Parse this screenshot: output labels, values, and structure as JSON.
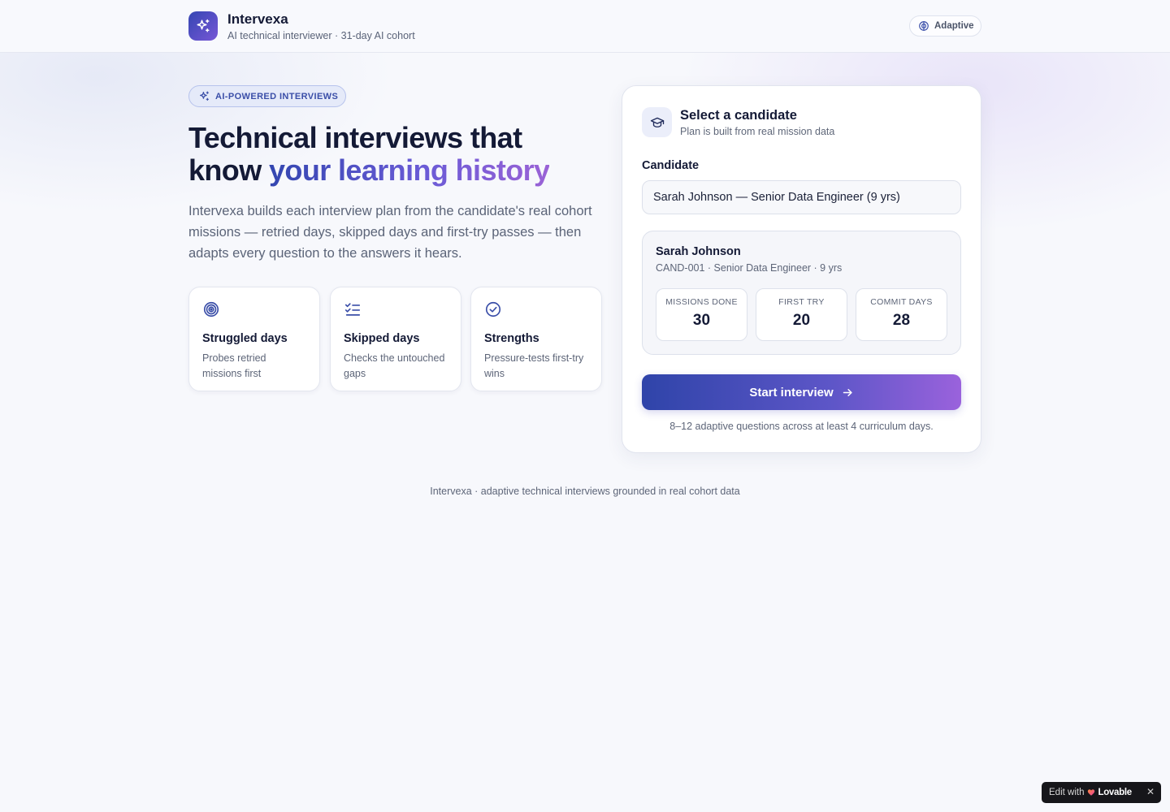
{
  "header": {
    "app_name": "Intervexa",
    "subtitle": "AI technical interviewer · 31-day AI cohort",
    "mode_label": "Adaptive"
  },
  "hero": {
    "badge": "AI-POWERED INTERVIEWS",
    "title_line1": "Technical interviews that",
    "title_line2_plain": "know ",
    "title_line2_accent": "your learning history",
    "description": "Intervexa builds each interview plan from the candidate's real cohort missions — retried days, skipped days and first-try passes — then adapts every question to the answers it hears."
  },
  "features": [
    {
      "icon": "target-icon",
      "title": "Struggled days",
      "description": "Probes retried missions first"
    },
    {
      "icon": "checklist-icon",
      "title": "Skipped days",
      "description": "Checks the untouched gaps"
    },
    {
      "icon": "check-circle-icon",
      "title": "Strengths",
      "description": "Pressure-tests first-try wins"
    }
  ],
  "panel": {
    "title": "Select a candidate",
    "subtitle": "Plan is built from real mission data",
    "candidate_label": "Candidate",
    "selected_candidate": "Sarah Johnson — Senior Data Engineer (9 yrs)",
    "profile": {
      "name": "Sarah Johnson",
      "meta": "CAND-001 · Senior Data Engineer · 9 yrs",
      "stats": [
        {
          "label": "MISSIONS DONE",
          "value": "30"
        },
        {
          "label": "FIRST TRY",
          "value": "20"
        },
        {
          "label": "COMMIT DAYS",
          "value": "28"
        }
      ]
    },
    "start_button": "Start interview",
    "hint": "8–12 adaptive questions across at least 4 curriculum days."
  },
  "footer": {
    "text": "Intervexa · adaptive technical interviews grounded in real cohort data"
  },
  "lovable_badge": {
    "prefix": "Edit with",
    "brand": "Lovable",
    "close": "✕"
  },
  "colors": {
    "accent_start": "#3346b0",
    "accent_end": "#9a62d6",
    "text_primary": "#141a36",
    "text_muted": "#5d6578",
    "background": "#f7f8fc"
  }
}
